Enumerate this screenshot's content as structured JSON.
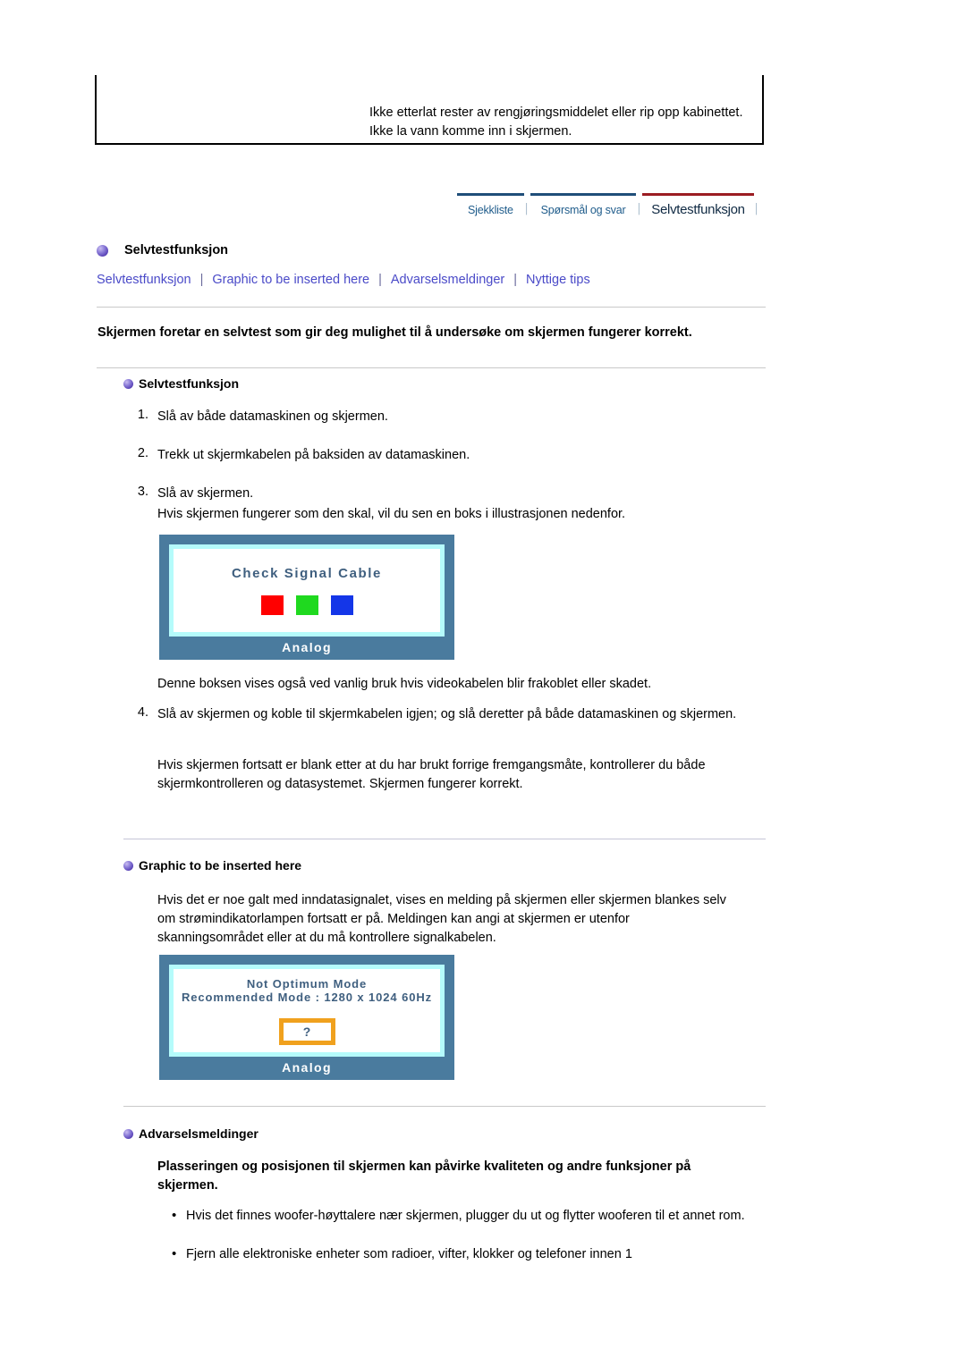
{
  "warning_box": {
    "text": "Ikke etterlat rester av rengjøringsmiddelet eller rip opp kabinettet. Ikke la vann komme inn i skjermen."
  },
  "tabs": [
    {
      "label": "Sjekkliste",
      "active": false
    },
    {
      "label": "Spørsmål og svar",
      "active": false
    },
    {
      "label": "Selvtestfunksjon",
      "active": true
    }
  ],
  "tab_separator": "│",
  "page": {
    "title": "Selvtestfunksjon",
    "bullet_icon": "sphere-bullet-icon"
  },
  "subnav": {
    "separator": "|",
    "items": [
      {
        "label": "Selvtestfunksjon"
      },
      {
        "label": "Graphic to be inserted here"
      },
      {
        "label": "Advarselsmeldinger"
      },
      {
        "label": "Nyttige tips"
      }
    ]
  },
  "lead": "Skjermen foretar en selvtest som gir deg mulighet til å undersøke om skjermen fungerer korrekt.",
  "section_selvtest": {
    "heading": "Selvtestfunksjon",
    "steps": [
      {
        "num": "1.",
        "text": "Slå av både datamaskinen og skjermen."
      },
      {
        "num": "2.",
        "text": "Trekk ut skjermkabelen på baksiden av datamaskinen."
      },
      {
        "num": "3.",
        "text": "Slå av skjermen."
      }
    ],
    "step3_note": "Hvis skjermen fungerer som den skal, vil du sen en boks i illustrasjonen nedenfor.",
    "after_graphic_note": "Denne boksen vises også ved vanlig bruk hvis videokabelen blir frakoblet eller skadet.",
    "step4": {
      "num": "4.",
      "text": "Slå av skjermen og koble til skjermkabelen igjen; og slå deretter på både datamaskinen og skjermen."
    },
    "step4_note": "Hvis skjermen fortsatt er blank etter at du har brukt forrige fremgangsmåte, kontrollerer du både skjermkontrolleren og datasystemet. Skjermen fungerer korrekt."
  },
  "monitor_check_signal": {
    "osd_title": "Check Signal Cable",
    "swatches": [
      {
        "name": "red-swatch",
        "color": "#ff0000"
      },
      {
        "name": "green-swatch",
        "color": "#1fd91f"
      },
      {
        "name": "blue-swatch",
        "color": "#1436e8"
      }
    ],
    "footer_label": "Analog",
    "frame_color": "#4a7b9e",
    "inner_border_color": "#b5fbfb"
  },
  "section_graphic": {
    "heading": "Graphic to be inserted here",
    "paragraph": "Hvis det er noe galt med inndatasignalet, vises en melding på skjermen eller skjermen blankes selv om strømindikatorlampen fortsatt er på. Meldingen kan angi at skjermen er utenfor skanningsområdet eller at du må kontrollere signalkabelen."
  },
  "monitor_not_optimum": {
    "osd_line1": "Not Optimum Mode",
    "osd_line2": "Recommended Mode : 1280 x 1024  60Hz",
    "question_mark": "?",
    "question_box_color": "#f0a11e",
    "footer_label": "Analog"
  },
  "section_advarsel": {
    "heading": "Advarselsmeldinger",
    "subheading": "Plasseringen og posisjonen til skjermen kan påvirke kvaliteten og andre funksjoner på skjermen.",
    "bullet_glyph": "•",
    "bullets": [
      "Hvis det finnes woofer-høyttalere nær skjermen, plugger du ut og flytter wooferen til et annet rom.",
      "Fjern alle elektroniske enheter som radioer, vifter, klokker og telefoner innen 1"
    ]
  }
}
